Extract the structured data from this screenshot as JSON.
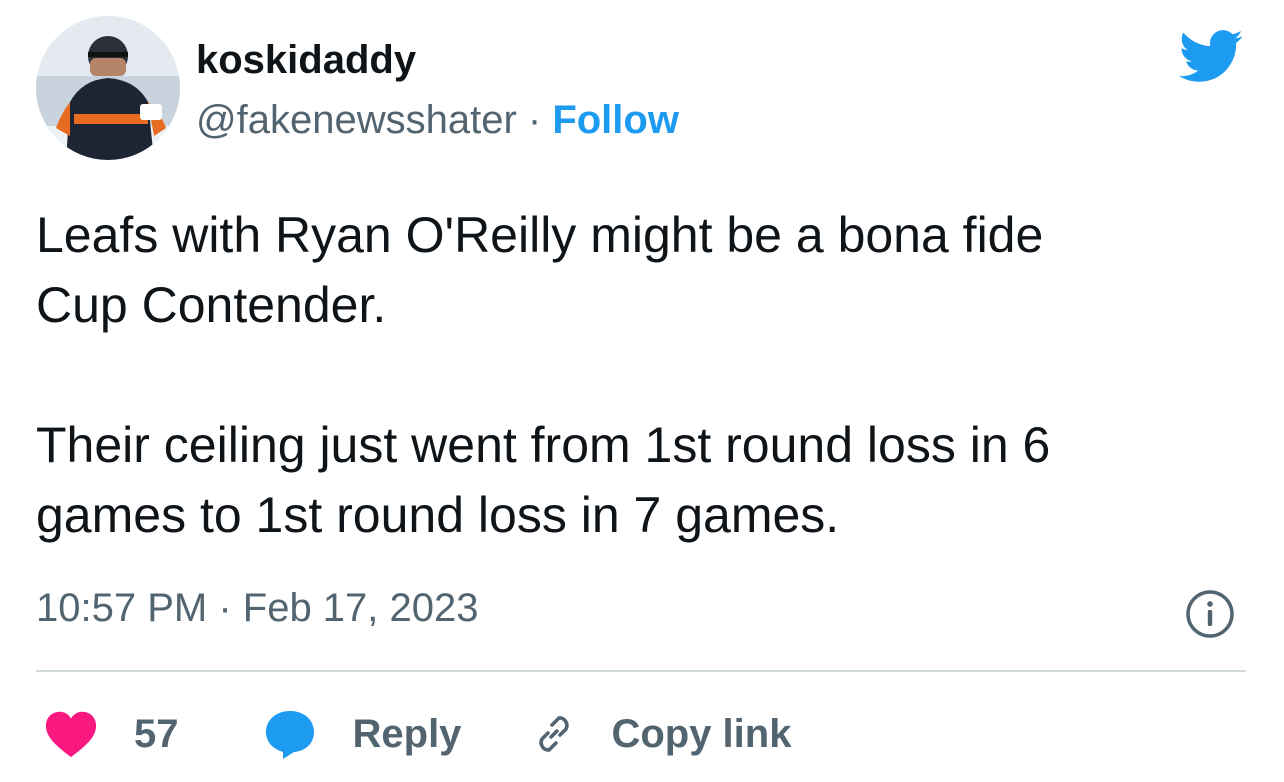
{
  "author": {
    "display_name": "koskidaddy",
    "handle": "@fakenewsshater",
    "separator": " · ",
    "follow_label": "Follow"
  },
  "tweet": {
    "paragraphs": [
      "Leafs with Ryan O'Reilly might be a bona fide\nCup Contender.",
      "Their ceiling just went from 1st round loss in 6\ngames to 1st round loss in 7 games."
    ],
    "timestamp": "10:57 PM · Feb 17, 2023"
  },
  "actions": {
    "like_count": "57",
    "reply_label": "Reply",
    "copy_link_label": "Copy link"
  },
  "colors": {
    "brand_blue": "#1d9bf0",
    "heart_pink": "#f91880",
    "text_primary": "#0f1419",
    "text_secondary": "#536471",
    "divider": "#cfd9de"
  },
  "icons": {
    "brand": "twitter-bird-icon",
    "info": "info-icon",
    "like": "heart-icon",
    "reply": "speech-bubble-icon",
    "copy": "link-icon"
  }
}
